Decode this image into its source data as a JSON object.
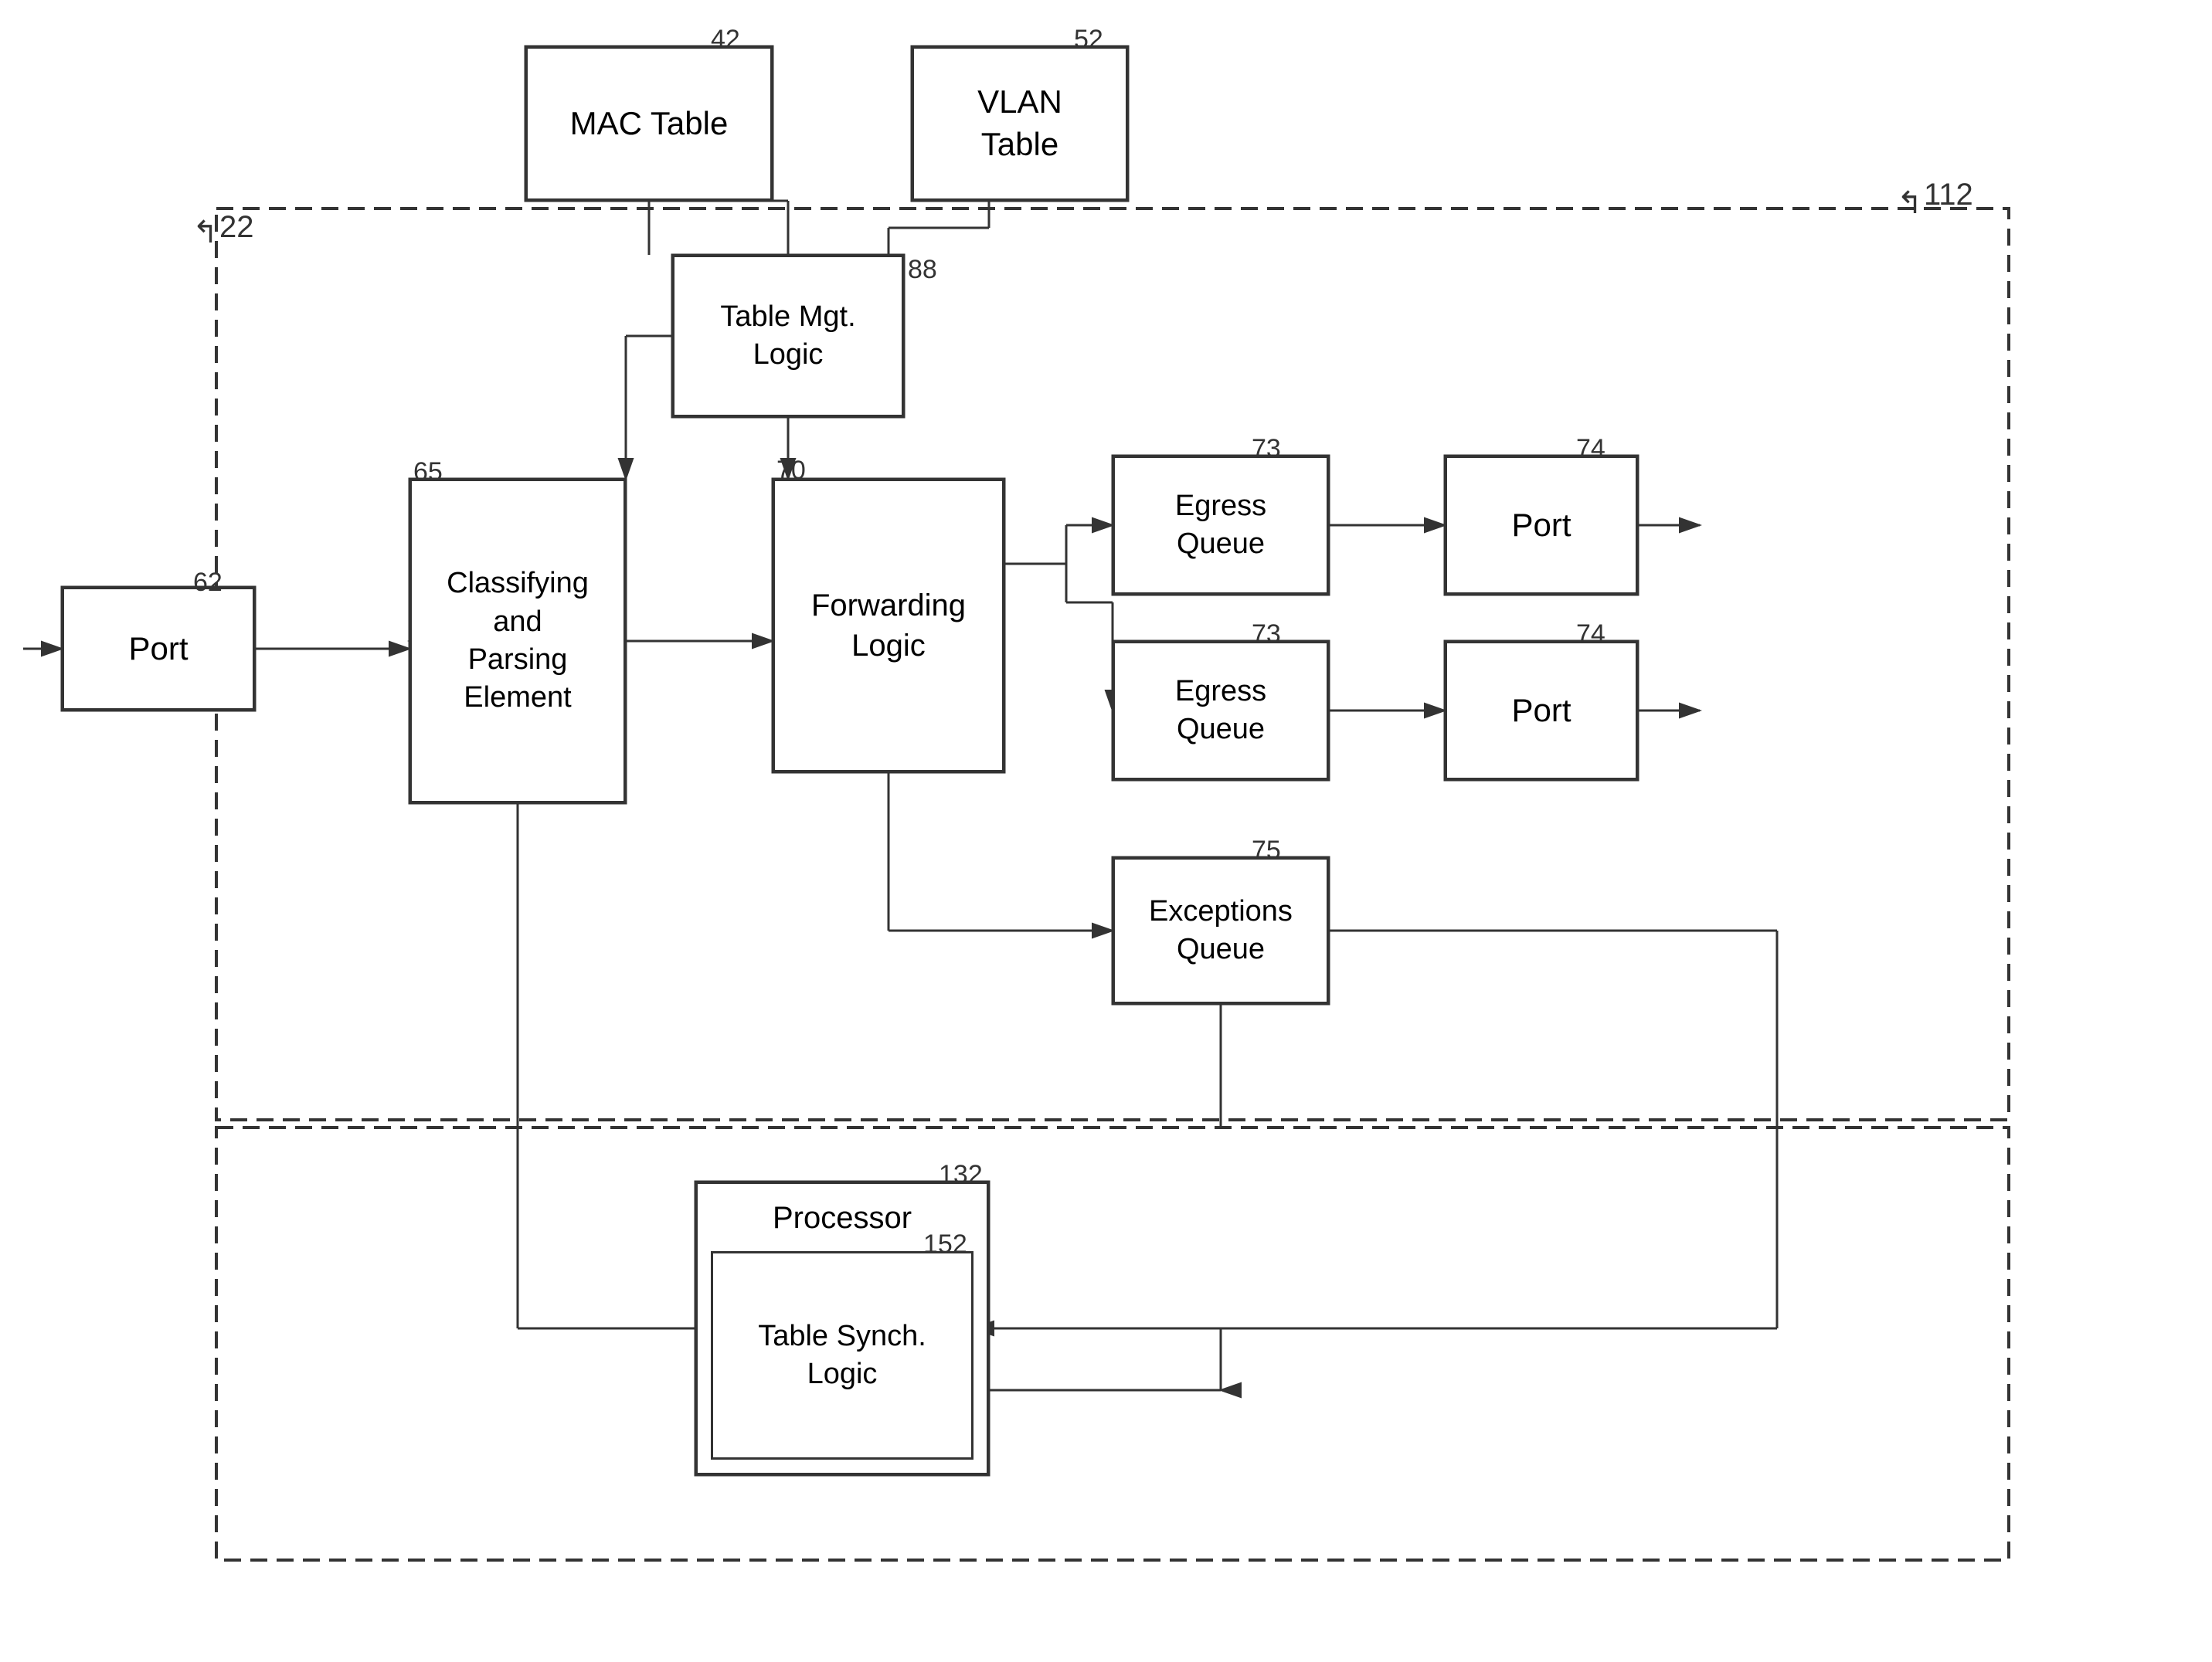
{
  "blocks": {
    "mac_table": {
      "label": "MAC Table",
      "ref": "42"
    },
    "vlan_table": {
      "label": "VLAN\nTable",
      "ref": "52"
    },
    "table_mgt": {
      "label": "Table Mgt.\nLogic",
      "ref": "88"
    },
    "classifying": {
      "label": "Classifying\nand\nParsing\nElement",
      "ref": "65"
    },
    "forwarding": {
      "label": "Forwarding\nLogic",
      "ref": "70"
    },
    "egress1": {
      "label": "Egress\nQueue",
      "ref": "73"
    },
    "egress2": {
      "label": "Egress\nQueue",
      "ref": "73"
    },
    "port_in": {
      "label": "Port",
      "ref": "62"
    },
    "port1": {
      "label": "Port",
      "ref": "74"
    },
    "port2": {
      "label": "Port",
      "ref": "74"
    },
    "exceptions": {
      "label": "Exceptions\nQueue",
      "ref": "75"
    },
    "processor": {
      "label": "Processor",
      "ref": "132"
    },
    "table_synch": {
      "label": "Table Synch.\nLogic",
      "ref": "152"
    }
  },
  "refs": {
    "r22": "22",
    "r112": "112"
  }
}
